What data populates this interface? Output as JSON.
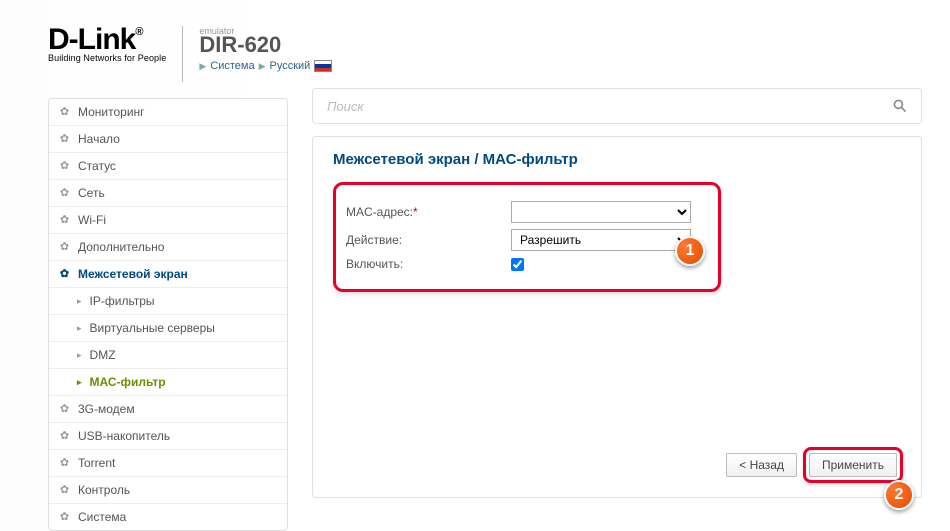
{
  "header": {
    "brand": "D-Link",
    "brand_sub": "Building Networks for People",
    "emulator": "emulator",
    "model": "DIR-620",
    "breadcrumb1": "Система",
    "breadcrumb2": "Русский"
  },
  "search": {
    "placeholder": "Поиск"
  },
  "sidebar": {
    "items": [
      "Мониторинг",
      "Начало",
      "Статус",
      "Сеть",
      "Wi-Fi",
      "Дополнительно",
      "Межсетевой экран",
      "3G-модем",
      "USB-накопитель",
      "Torrent",
      "Контроль",
      "Система"
    ],
    "firewall_sub": [
      "IP-фильтры",
      "Виртуальные серверы",
      "DMZ",
      "МАС-фильтр"
    ]
  },
  "panel": {
    "title": "Межсетевой экран /  МАС-фильтр",
    "mac_label": "MAC-адрес:",
    "action_label": "Действие:",
    "action_value": "Разрешить",
    "enable_label": "Включить:",
    "enable_checked": true
  },
  "buttons": {
    "back": "< Назад",
    "apply": "Применить"
  },
  "annotations": {
    "b1": "1",
    "b2": "2"
  }
}
